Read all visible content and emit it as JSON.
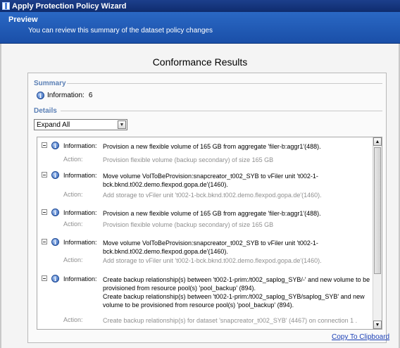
{
  "window": {
    "title": "Apply Protection Policy Wizard"
  },
  "preview": {
    "title": "Preview",
    "subtitle": "You can review this summary of the dataset policy changes"
  },
  "main": {
    "heading": "Conformance Results",
    "summary": {
      "label": "Summary",
      "info_label": "Information:",
      "info_count": "6"
    },
    "details": {
      "label": "Details",
      "select_value": "Expand All",
      "entries": [
        {
          "type": "Information:",
          "message": "Provision a new flexible volume of 165 GB from aggregate 'filer-b:aggr1'(488).",
          "action_label": "Action:",
          "action": "Provision flexible volume (backup secondary) of size 165 GB"
        },
        {
          "type": "Information:",
          "message": "Move volume VolToBeProvision:snapcreator_t002_SYB to vFiler unit 't002-1-bck.bknd.t002.demo.flexpod.gopa.de'(1460).",
          "action_label": "Action:",
          "action": "Add storage to vFiler unit 't002-1-bck.bknd.t002.demo.flexpod.gopa.de'(1460)."
        },
        {
          "type": "Information:",
          "message": "Provision a new flexible volume of 165 GB from aggregate 'filer-b:aggr1'(488).",
          "action_label": "Action:",
          "action": "Provision flexible volume (backup secondary) of size 165 GB"
        },
        {
          "type": "Information:",
          "message": "Move volume VolToBeProvision:snapcreator_t002_SYB to vFiler unit 't002-1-bck.bknd.t002.demo.flexpod.gopa.de'(1460).",
          "action_label": "Action:",
          "action": "Add storage to vFiler unit 't002-1-bck.bknd.t002.demo.flexpod.gopa.de'(1460)."
        },
        {
          "type": "Information:",
          "message": "Create backup relationship(s) between 't002-1-prim:/t002_saplog_SYB/-' and new volume to be provisioned from resource pool(s) 'pool_backup' (894).\nCreate backup relationship(s) between 't002-1-prim:/t002_saplog_SYB/saplog_SYB' and new volume to be provisioned from resource pool(s) 'pool_backup' (894).",
          "action_label": "Action:",
          "action": "Create backup relationship(s) for dataset 'snapcreator_t002_SYB' (4467) on connection 1 ."
        }
      ]
    },
    "copy_link": "Copy To Clipboard"
  },
  "icons": {
    "info": "info-icon",
    "collapse": "collapse-minus-icon",
    "dropdown": "chevron-down-icon",
    "scroll_up": "arrow-up-icon",
    "scroll_down": "arrow-down-icon"
  },
  "colors": {
    "header_blue": "#1a4fa8",
    "section_label": "#5a7fb5",
    "link": "#1a3fb5"
  }
}
